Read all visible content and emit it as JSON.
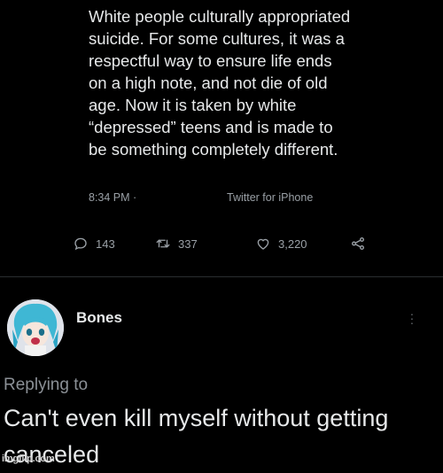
{
  "tweet": {
    "text": "White people culturally appropriated\nsuicide. For some cultures, it was a\nrespectful way to ensure life ends\non a high note, and not die of old\nage. Now it is taken by white\n“depressed” teens and is made to\nbe something completely different.",
    "time": "8:34 PM ·",
    "source": "Twitter for iPhone",
    "replies": "143",
    "retweets": "337",
    "likes": "3,220"
  },
  "reply": {
    "name": "Bones",
    "replying_to": "Replying to",
    "text": "Can't even kill myself without getting canceled"
  },
  "watermark": "imgflip.com",
  "icons": {
    "reply": "comment-icon",
    "retweet": "retweet-icon",
    "like": "heart-icon",
    "share": "share-icon",
    "more": "more-vertical-icon"
  },
  "colors": {
    "background": "#000000",
    "text": "#e7e9ea",
    "muted": "#9aa0a6"
  }
}
